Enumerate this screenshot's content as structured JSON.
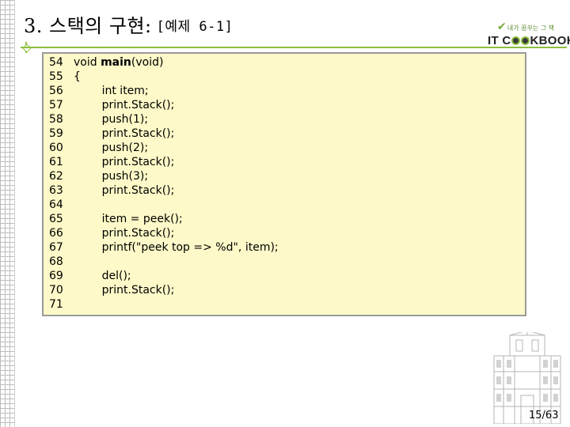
{
  "slide": {
    "title": "3. 스택의 구현:",
    "subtitle": "[예제 6-1]",
    "page": "15/63"
  },
  "logo": {
    "tagline": "내가 꿈꾸는 그 책",
    "wordmark": "IT COOKBOOK"
  },
  "code": {
    "lines": [
      {
        "num": "54",
        "text": "void ",
        "bold": "main",
        "rest": "(void)"
      },
      {
        "num": "55",
        "text": "{"
      },
      {
        "num": "56",
        "text": "        int item;"
      },
      {
        "num": "57",
        "text": "        print.Stack();"
      },
      {
        "num": "58",
        "text": "        push(1);"
      },
      {
        "num": "59",
        "text": "        print.Stack();"
      },
      {
        "num": "60",
        "text": "        push(2);"
      },
      {
        "num": "61",
        "text": "        print.Stack();"
      },
      {
        "num": "62",
        "text": "        push(3);"
      },
      {
        "num": "63",
        "text": "        print.Stack();"
      },
      {
        "num": "64",
        "text": ""
      },
      {
        "num": "65",
        "text": "        item = peek();"
      },
      {
        "num": "66",
        "text": "        print.Stack();"
      },
      {
        "num": "67",
        "text": "        printf(\"peek top => %d\", item);"
      },
      {
        "num": "68",
        "text": ""
      },
      {
        "num": "69",
        "text": "        del();"
      },
      {
        "num": "70",
        "text": "        print.Stack();"
      },
      {
        "num": "71",
        "text": ""
      }
    ]
  }
}
